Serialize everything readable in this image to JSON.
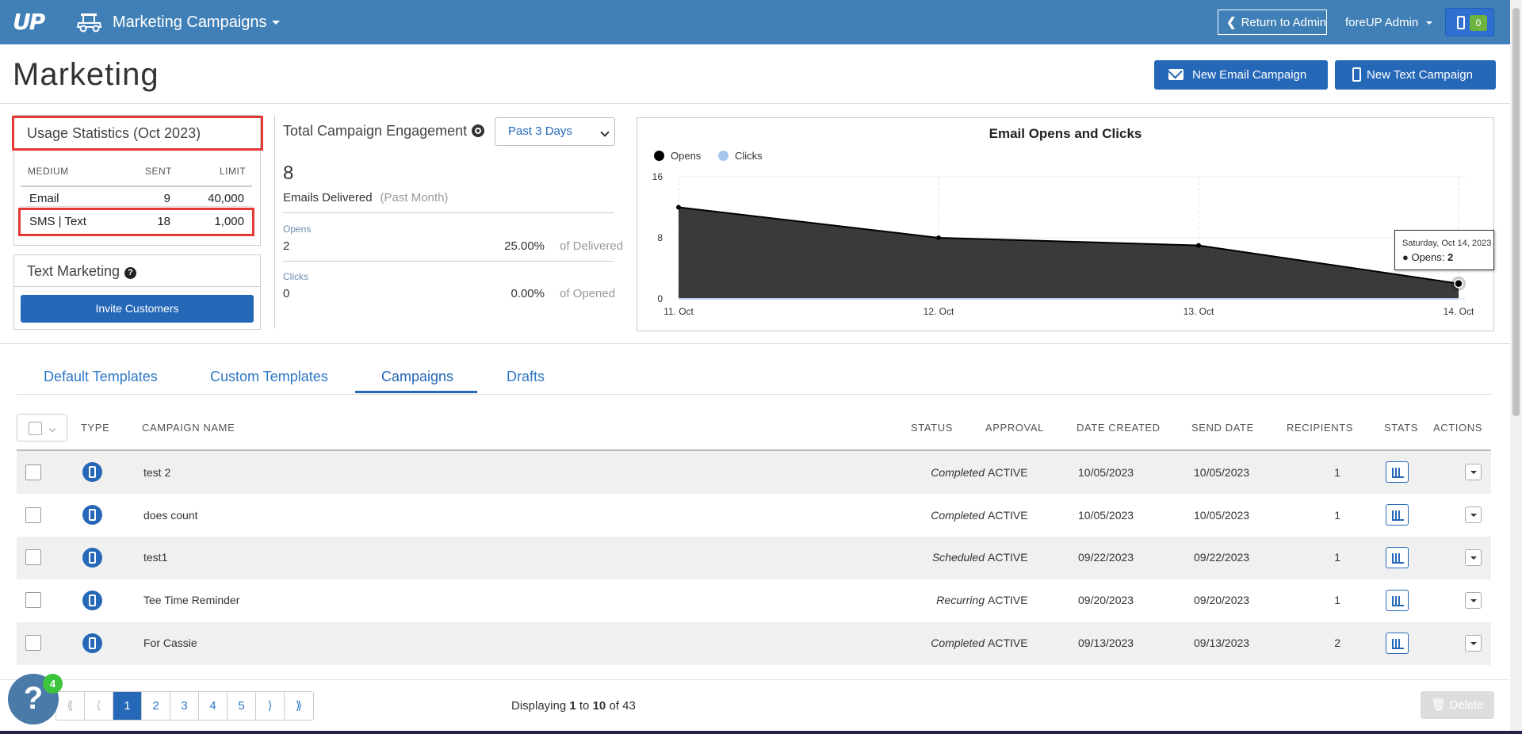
{
  "nav": {
    "logo": "UP",
    "title": "Marketing Campaigns",
    "return_label": "Return to Admin",
    "admin_label": "foreUP Admin",
    "notification_count": "0"
  },
  "header": {
    "title": "Marketing",
    "new_email_label": "New Email Campaign",
    "new_text_label": "New Text Campaign"
  },
  "usage": {
    "title": "Usage Statistics (Oct 2023)",
    "columns": [
      "MEDIUM",
      "SENT",
      "LIMIT"
    ],
    "rows": [
      {
        "medium": "Email",
        "sent": "9",
        "limit": "40,000"
      },
      {
        "medium": "SMS | Text",
        "sent": "18",
        "limit": "1,000"
      }
    ]
  },
  "text_marketing": {
    "title": "Text Marketing",
    "invite_label": "Invite Customers"
  },
  "engagement": {
    "title": "Total Campaign Engagement",
    "range": "Past 3 Days",
    "delivered_count": "8",
    "delivered_label": "Emails Delivered",
    "delivered_period": "(Past Month)",
    "opens_label": "Opens",
    "opens_value": "2",
    "opens_pct": "25.00%",
    "opens_of": "of Delivered",
    "clicks_label": "Clicks",
    "clicks_value": "0",
    "clicks_pct": "0.00%",
    "clicks_of": "of Opened"
  },
  "chart_data": {
    "type": "area",
    "title": "Email Opens and Clicks",
    "categories": [
      "11. Oct",
      "12. Oct",
      "13. Oct",
      "14. Oct"
    ],
    "series": [
      {
        "name": "Opens",
        "values": [
          12,
          8,
          7,
          2
        ],
        "color": "#000000"
      },
      {
        "name": "Clicks",
        "values": [
          0,
          0,
          0,
          0
        ],
        "color": "#a6c8ec"
      }
    ],
    "ylim": [
      0,
      16
    ],
    "yticks": [
      "0",
      "8",
      "16"
    ],
    "legend_position": "top-left",
    "grid": true,
    "tooltip": {
      "line1": "Saturday, Oct 14, 2023",
      "series": "Opens",
      "value": "2"
    }
  },
  "tabs": [
    "Default Templates",
    "Custom Templates",
    "Campaigns",
    "Drafts"
  ],
  "active_tab": "Campaigns",
  "table": {
    "columns": [
      "TYPE",
      "CAMPAIGN NAME",
      "STATUS",
      "APPROVAL",
      "DATE CREATED",
      "SEND DATE",
      "RECIPIENTS",
      "STATS",
      "ACTIONS"
    ],
    "rows": [
      {
        "name": "test 2",
        "status": "Completed",
        "approval": "ACTIVE",
        "created": "10/05/2023",
        "send": "10/05/2023",
        "recipients": "1"
      },
      {
        "name": "does count",
        "status": "Completed",
        "approval": "ACTIVE",
        "created": "10/05/2023",
        "send": "10/05/2023",
        "recipients": "1"
      },
      {
        "name": "test1",
        "status": "Scheduled",
        "approval": "ACTIVE",
        "created": "09/22/2023",
        "send": "09/22/2023",
        "recipients": "1"
      },
      {
        "name": "Tee Time Reminder",
        "status": "Recurring",
        "approval": "ACTIVE",
        "created": "09/20/2023",
        "send": "09/20/2023",
        "recipients": "1"
      },
      {
        "name": "For Cassie",
        "status": "Completed",
        "approval": "ACTIVE",
        "created": "09/13/2023",
        "send": "09/13/2023",
        "recipients": "2"
      }
    ]
  },
  "footer": {
    "pages": [
      "1",
      "2",
      "3",
      "4",
      "5"
    ],
    "current_page": "1",
    "first_symbol": "⟪",
    "prev_symbol": "⟨",
    "next_symbol": "⟩",
    "last_symbol": "⟫",
    "display_prefix": "Displaying",
    "display_from": "1",
    "display_to_word": "to",
    "display_to": "10",
    "display_of_word": "of",
    "display_total": "43",
    "delete_label": "Delete",
    "help_badge": "4",
    "help_symbol": "?"
  }
}
